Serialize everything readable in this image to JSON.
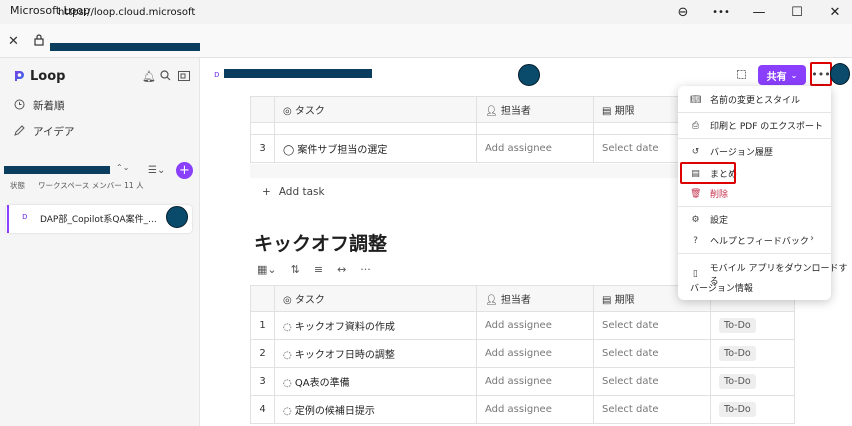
{
  "window": {
    "title": "Microsoft Loop",
    "zoom_icon": "⊖",
    "more": "•••",
    "minimize": "—",
    "maximize": "☐",
    "close": "✕"
  },
  "address": {
    "url": "https://loop.cloud.microsoft"
  },
  "sidebar": {
    "app_name": "Loop",
    "nav": [
      {
        "label": "新着順",
        "icon": "clock-icon"
      },
      {
        "label": "アイデア",
        "icon": "pen-icon"
      }
    ],
    "workspace_status": "状態",
    "workspace_members": "ワークスペース メンバー 11 人",
    "page_item": "DAP部_Copilot系QA案件_..."
  },
  "header": {
    "share_label": "共有",
    "more_label": "•••"
  },
  "table1": {
    "headers": {
      "task": "タスク",
      "assignee": "担当者",
      "due": "期限"
    },
    "rows": [
      {
        "num": "3",
        "task": "案件サブ担当の選定",
        "assignee": "Add assignee",
        "due": "Select date"
      }
    ],
    "add_task": "Add task"
  },
  "section2": {
    "title": "キックオフ調整"
  },
  "table2": {
    "headers": {
      "task": "タスク",
      "assignee": "担当者",
      "due": "期限"
    },
    "rows": [
      {
        "num": "1",
        "task": "キックオフ資料の作成",
        "assignee": "Add assignee",
        "due": "Select date",
        "status": "To-Do"
      },
      {
        "num": "2",
        "task": "キックオフ日時の調整",
        "assignee": "Add assignee",
        "due": "Select date",
        "status": "To-Do"
      },
      {
        "num": "3",
        "task": "QA表の準備",
        "assignee": "Add assignee",
        "due": "Select date",
        "status": "To-Do"
      },
      {
        "num": "4",
        "task": "定例の候補日提示",
        "assignee": "Add assignee",
        "due": "Select date",
        "status": "To-Do"
      }
    ]
  },
  "menu": {
    "items": [
      {
        "label": "名前の変更とスタイル",
        "icon": "book-icon"
      },
      {
        "label": "印刷と PDF のエクスポート",
        "icon": "printer-icon"
      },
      {
        "label": "バージョン履歴",
        "icon": "history-icon"
      },
      {
        "label": "まとめ",
        "icon": "summary-icon"
      },
      {
        "label": "削除",
        "icon": "trash-icon"
      },
      {
        "label": "設定",
        "icon": "gear-icon"
      },
      {
        "label": "ヘルプとフィードバック",
        "icon": "help-icon"
      },
      {
        "label": "モバイル アプリをダウンロードする",
        "icon": "phone-icon"
      },
      {
        "label": "バージョン情報",
        "icon": ""
      }
    ]
  },
  "colors": {
    "accent": "#8a3ffc",
    "delete": "#c4314b",
    "highlight": "#dd0000"
  }
}
